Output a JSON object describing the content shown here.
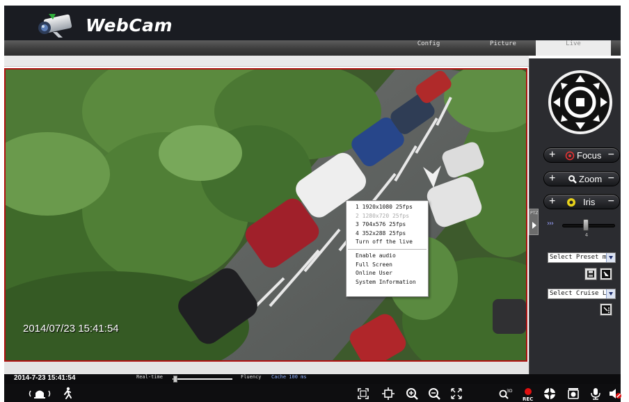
{
  "header": {
    "title": "WebCam",
    "logo_icon": "webcam-logo-icon"
  },
  "nav": {
    "config": "Config",
    "picture": "Picture",
    "live": "Live"
  },
  "video": {
    "osd_timestamp": "2014/07/23 15:41:54"
  },
  "context_menu": {
    "items": [
      {
        "label": "1 1920x1080 25fps",
        "enabled": true
      },
      {
        "label": "2 1280x720 25fps",
        "enabled": false
      },
      {
        "label": "3 704x576 25fps",
        "enabled": true
      },
      {
        "label": "4 352x288 25fps",
        "enabled": true
      },
      {
        "label": "Turn off the live",
        "enabled": true
      }
    ],
    "items2": [
      {
        "label": "Enable audio"
      },
      {
        "label": "Full Screen"
      },
      {
        "label": "Online User"
      },
      {
        "label": "System Information"
      }
    ]
  },
  "ptz": {
    "tab_label": "PTZ",
    "focus_label": "Focus",
    "zoom_label": "Zoom",
    "iris_label": "Iris",
    "plus": "+",
    "minus": "−",
    "speed_arrows": "›››",
    "speed_value": "4",
    "preset_select": "Select Preset mod",
    "cruise_select": "Select Cruise Lin"
  },
  "status": {
    "datetime": "2014-7-23 15:41:54",
    "realtime_label": "Real-time",
    "fluency_label": "Fluency",
    "cache_label": "Cache 100 ms"
  },
  "toolbar": {
    "icons": [
      "intercom-icon",
      "motion-person-icon",
      "fit-window-icon",
      "original-size-icon",
      "zoom-in-icon",
      "zoom-out-icon",
      "fullscreen-icon",
      "digital-zoom-icon",
      "record-icon",
      "ptz-wheel-icon",
      "snapshot-icon",
      "microphone-icon",
      "speaker-mute-icon"
    ],
    "rec_label": "REC",
    "zoom3d_label": "3D"
  },
  "colors": {
    "video_border": "#b01010",
    "header_bg": "#1a1c22",
    "cache_text": "#8fb0ff",
    "record": "#e01010"
  }
}
